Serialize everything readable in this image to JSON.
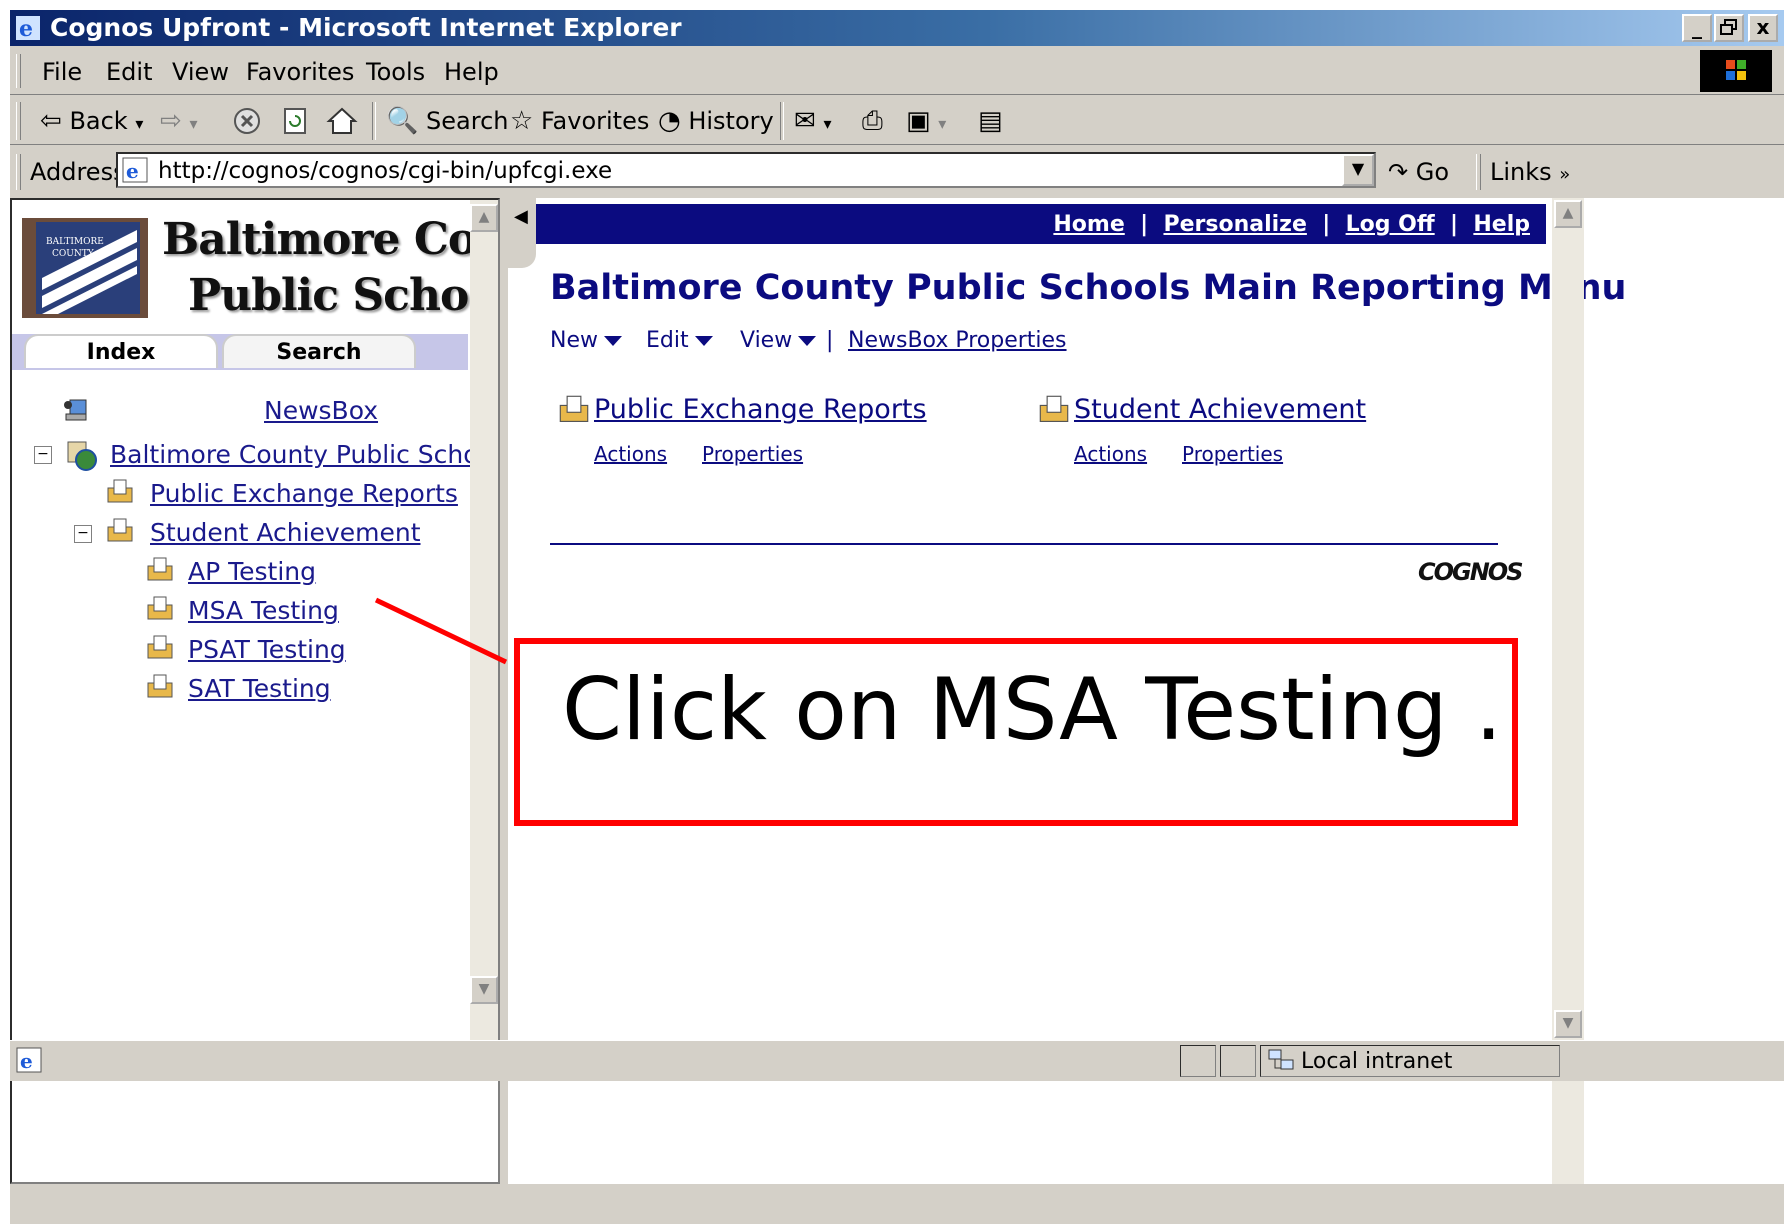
{
  "window": {
    "title": "Cognos Upfront - Microsoft Internet Explorer",
    "controls": [
      "_",
      "▫",
      "x"
    ]
  },
  "menubar": {
    "items": [
      {
        "label": "File"
      },
      {
        "label": "Edit"
      },
      {
        "label": "View"
      },
      {
        "label": "Favorites"
      },
      {
        "label": "Tools"
      },
      {
        "label": "Help"
      }
    ]
  },
  "toolbar": {
    "back_label": "Back",
    "search_label": "Search",
    "favorites_label": "Favorites",
    "history_label": "History"
  },
  "address": {
    "label": "Address",
    "url": "http://cognos/cognos/cgi-bin/upfcgi.exe",
    "go_label": "Go",
    "links_label": "Links"
  },
  "left": {
    "logo_line1": "Baltimore County",
    "logo_line2": "Public Schools",
    "tabs": [
      "Index",
      "Search"
    ],
    "tree": {
      "newsbox": "NewsBox",
      "root": "Baltimore County Public School",
      "children": [
        "Public Exchange Reports",
        "Student Achievement"
      ],
      "grandchildren": [
        "AP Testing",
        "MSA Testing",
        "PSAT Testing",
        "SAT Testing"
      ]
    }
  },
  "right": {
    "nav": [
      "Home",
      "Personalize",
      "Log Off",
      "Help"
    ],
    "title": "Baltimore County Public Schools Main Reporting Menu",
    "menus": [
      "New",
      "Edit",
      "View"
    ],
    "newsbox_properties": "NewsBox Properties",
    "entries": [
      {
        "title": "Public Exchange Reports",
        "actions": "Actions",
        "properties": "Properties"
      },
      {
        "title": "Student Achievement",
        "actions": "Actions",
        "properties": "Properties"
      }
    ],
    "brand": "COGNOS"
  },
  "callout": {
    "text": "Click  on  MSA  Testing ."
  },
  "status": {
    "zone": "Local intranet"
  }
}
